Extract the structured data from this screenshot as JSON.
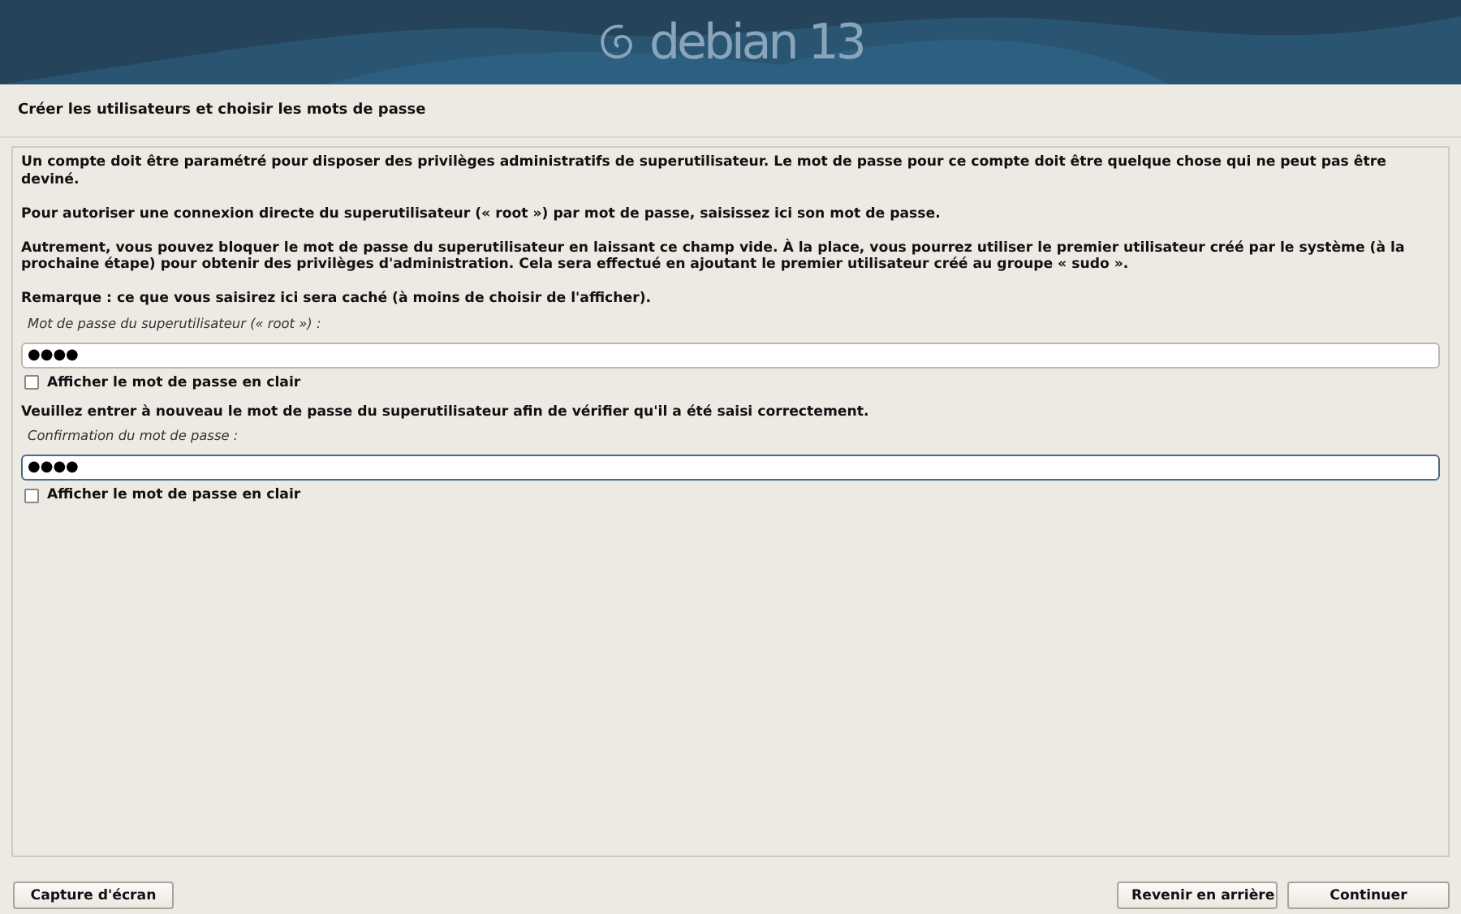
{
  "banner": {
    "logo_text": "debian",
    "version": "13"
  },
  "step_title": "Créer les utilisateurs et choisir les mots de passe",
  "paragraphs": [
    "Un compte doit être paramétré pour disposer des privilèges administratifs de superutilisateur. Le mot de passe pour ce compte doit être quelque chose qui ne peut pas être deviné.",
    "Pour autoriser une connexion directe du superutilisateur (« root ») par mot de passe, saisissez ici son mot de passe.",
    "Autrement, vous pouvez bloquer le mot de passe du superutilisateur en laissant ce champ vide. À la place, vous pourrez utiliser le premier utilisateur créé par le système (à la prochaine étape) pour obtenir des privilèges d'administration. Cela sera effectué en ajoutant le premier utilisateur créé au groupe « sudo »."
  ],
  "fields": [
    {
      "intro": "Remarque : ce que vous saisirez ici sera caché (à moins de choisir de l'afficher).",
      "label": "Mot de passe du superutilisateur (« root ») :",
      "value": "●●●●",
      "focused": false,
      "show_label": "Afficher le mot de passe en clair",
      "show_checked": false
    },
    {
      "intro": "Veuillez entrer à nouveau le mot de passe du superutilisateur afin de vérifier qu'il a été saisi correctement.",
      "label": "Confirmation du mot de passe :",
      "value": "●●●●",
      "focused": true,
      "show_label": "Afficher le mot de passe en clair",
      "show_checked": false
    }
  ],
  "buttons": {
    "left": [
      "Capture d'écran"
    ],
    "right": [
      "Revenir en arrière",
      "Continuer"
    ]
  }
}
